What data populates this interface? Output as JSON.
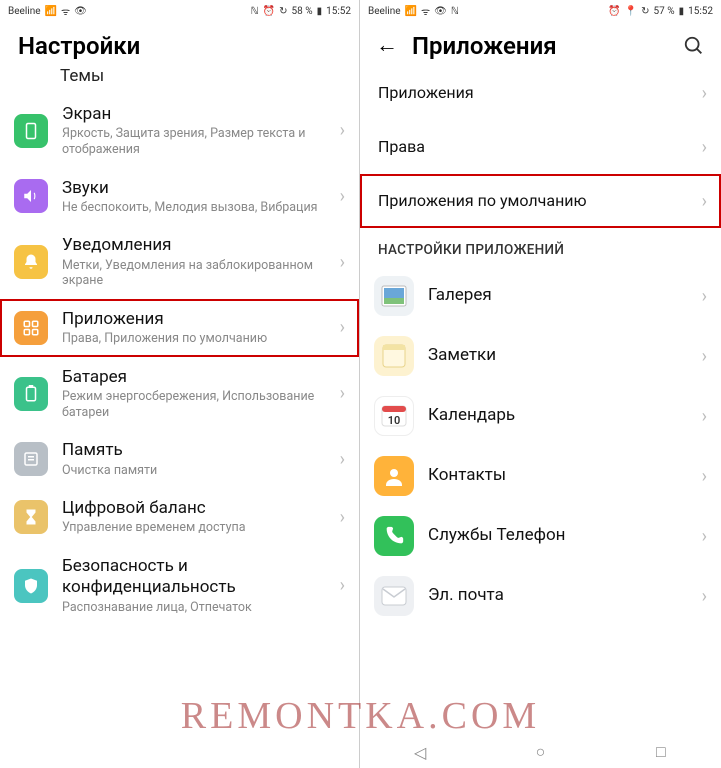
{
  "watermark": "REMONTKA.COM",
  "left": {
    "status": {
      "carrier": "Beeline",
      "nfc": "ℕ",
      "battery": "58 %",
      "time": "15:52"
    },
    "title": "Настройки",
    "partial_top": "Темы",
    "items": [
      {
        "title": "Экран",
        "sub": "Яркость, Защита зрения, Размер текста и отображения"
      },
      {
        "title": "Звуки",
        "sub": "Не беспокоить, Мелодия вызова, Вибрация"
      },
      {
        "title": "Уведомления",
        "sub": "Метки, Уведомления на заблокированном экране"
      },
      {
        "title": "Приложения",
        "sub": "Права, Приложения по умолчанию"
      },
      {
        "title": "Батарея",
        "sub": "Режим энергосбережения, Использование батареи"
      },
      {
        "title": "Память",
        "sub": "Очистка памяти"
      },
      {
        "title": "Цифровой баланс",
        "sub": "Управление временем доступа"
      },
      {
        "title": "Безопасность и конфиденциальность",
        "sub": "Распознавание лица, Отпечаток"
      }
    ]
  },
  "right": {
    "status": {
      "carrier": "Beeline",
      "battery": "57 %",
      "time": "15:52"
    },
    "title": "Приложения",
    "top_items": [
      {
        "title": "Приложения"
      },
      {
        "title": "Права"
      },
      {
        "title": "Приложения по умолчанию"
      }
    ],
    "section": "НАСТРОЙКИ ПРИЛОЖЕНИЙ",
    "apps": [
      {
        "title": "Галерея"
      },
      {
        "title": "Заметки"
      },
      {
        "title": "Календарь"
      },
      {
        "title": "Контакты"
      },
      {
        "title": "Службы Телефон"
      },
      {
        "title": "Эл. почта"
      }
    ]
  }
}
